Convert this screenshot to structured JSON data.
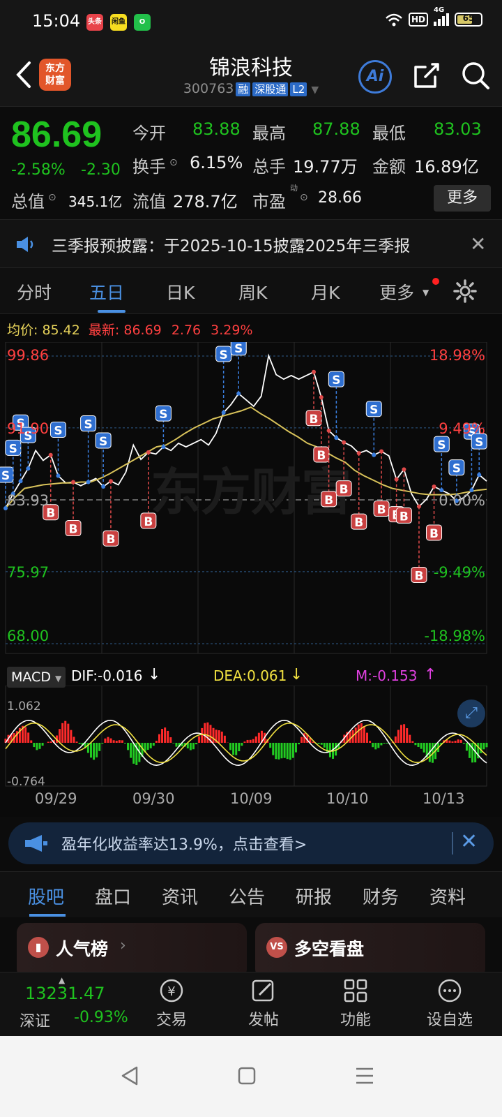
{
  "status_bar": {
    "time": "15:04",
    "app_badges": [
      "头条",
      "闲鱼",
      "O"
    ],
    "hd": "HD",
    "network": "4G",
    "battery": "65",
    "battery_level": 0.65
  },
  "header": {
    "logo_line1": "东方",
    "logo_line2": "财富",
    "stock_name": "锦浪科技",
    "stock_code": "300763",
    "tags": [
      "融",
      "深股通",
      "L2"
    ],
    "ai_label": "Ai"
  },
  "quote": {
    "price": "86.69",
    "pct_change": "-2.58%",
    "change": "-2.30",
    "open_label": "今开",
    "open": "83.88",
    "high_label": "最高",
    "high": "87.88",
    "low_label": "最低",
    "low": "83.03",
    "turnover_label": "换手",
    "turnover": "6.15%",
    "volume_label": "总手",
    "volume": "19.77万",
    "amount_label": "金额",
    "amount": "16.89亿",
    "total_cap_label": "总值",
    "total_cap": "345.1亿",
    "float_cap_label": "流值",
    "float_cap": "278.7亿",
    "pe_label": "市盈",
    "pe_sup": "动",
    "pe": "28.66",
    "more_label": "更多"
  },
  "notice": {
    "text": "三季报预披露：于2025-10-15披露2025年三季报"
  },
  "period_tabs": [
    {
      "label": "分时"
    },
    {
      "label": "五日"
    },
    {
      "label": "日K"
    },
    {
      "label": "周K"
    },
    {
      "label": "月K"
    },
    {
      "label": "更多"
    }
  ],
  "chart_header": {
    "avg_label": "均价:",
    "avg_value": "85.42",
    "latest_label": "最新:",
    "latest_value": "86.69",
    "latest_change": "2.76",
    "latest_pct": "3.29%"
  },
  "chart_data": {
    "type": "line",
    "y_left_ticks": [
      "99.86",
      "91.90",
      "83.93",
      "75.97",
      "68.00"
    ],
    "y_right_ticks": [
      "18.98%",
      "9.49%",
      "0.00%",
      "-9.49%",
      "-18.98%"
    ],
    "ylim": [
      68.0,
      99.86
    ],
    "prev_close": 83.93,
    "dates": [
      "09/29",
      "09/30",
      "10/09",
      "10/10",
      "10/13"
    ],
    "watermark": "东方财富",
    "series": [
      {
        "values": [
          83.0,
          84.6,
          86.0,
          87.4,
          89.4,
          88.3,
          88.9,
          86.6,
          85.8,
          85.9,
          85.5,
          85.9,
          86.3,
          85.4,
          86.0,
          85.6,
          87.0,
          90.0,
          88.4,
          89.2,
          89.0,
          89.8,
          89.4,
          90.2,
          89.8,
          90.2,
          90.6,
          90.0,
          91.3,
          93.6,
          94.5,
          95.7,
          95.0,
          94.3,
          95.4,
          99.9,
          97.8,
          97.3,
          97.7,
          97.3,
          97.7,
          98.1,
          95.3,
          91.6,
          90.8,
          90.3,
          89.9,
          89.1,
          89.4,
          88.9,
          89.3,
          88.8,
          86.2,
          87.3,
          84.6,
          83.2,
          84.0,
          85.4,
          85.0,
          84.6,
          83.8,
          84.2,
          85.0,
          86.7,
          86.0
        ]
      },
      {
        "values": [
          83.0,
          84.2,
          85.2,
          85.4,
          85.6,
          85.7,
          85.8,
          85.8,
          85.9,
          85.9,
          86.3,
          86.8,
          87.4,
          88.0,
          88.6,
          89.2,
          89.8,
          90.0,
          90.6,
          91.3,
          91.9,
          92.4,
          92.9,
          93.2,
          93.5,
          93.8,
          94.2,
          93.5,
          92.9,
          92.2,
          91.5,
          90.9,
          90.2,
          89.8,
          89.2,
          88.6,
          88.1,
          87.2,
          86.6,
          86.1,
          85.6,
          85.2,
          85.0,
          84.8,
          84.6,
          84.5,
          84.5,
          84.5,
          84.6,
          84.8,
          85.0,
          85.1
        ]
      }
    ],
    "trade_markers_sell": 18,
    "trade_markers_buy": 14
  },
  "macd": {
    "indicator": "MACD",
    "dif": "DIF:-0.016",
    "dea": "DEA:0.061",
    "m": "M:-0.153",
    "y_top": "1.062",
    "y_bottom": "-0.764"
  },
  "ad_banner": {
    "text": "盈年化收益率达13.9%，点击查看>"
  },
  "content_tabs": [
    {
      "label": "股吧"
    },
    {
      "label": "盘口"
    },
    {
      "label": "资讯"
    },
    {
      "label": "公告"
    },
    {
      "label": "研报"
    },
    {
      "label": "财务"
    },
    {
      "label": "资料"
    }
  ],
  "cards": [
    {
      "title": "人气榜"
    },
    {
      "title": "多空看盘"
    }
  ],
  "bottom_nav": {
    "index_value": "13231.47",
    "index_name": "深证",
    "index_pct": "-0.93%",
    "items": [
      {
        "label": "交易"
      },
      {
        "label": "发帖"
      },
      {
        "label": "功能"
      },
      {
        "label": "设自选"
      }
    ]
  },
  "colors": {
    "up": "#ff3b3b",
    "down": "#1fc21f",
    "accent": "#4a90e2",
    "avg_line": "#d8c25a"
  }
}
